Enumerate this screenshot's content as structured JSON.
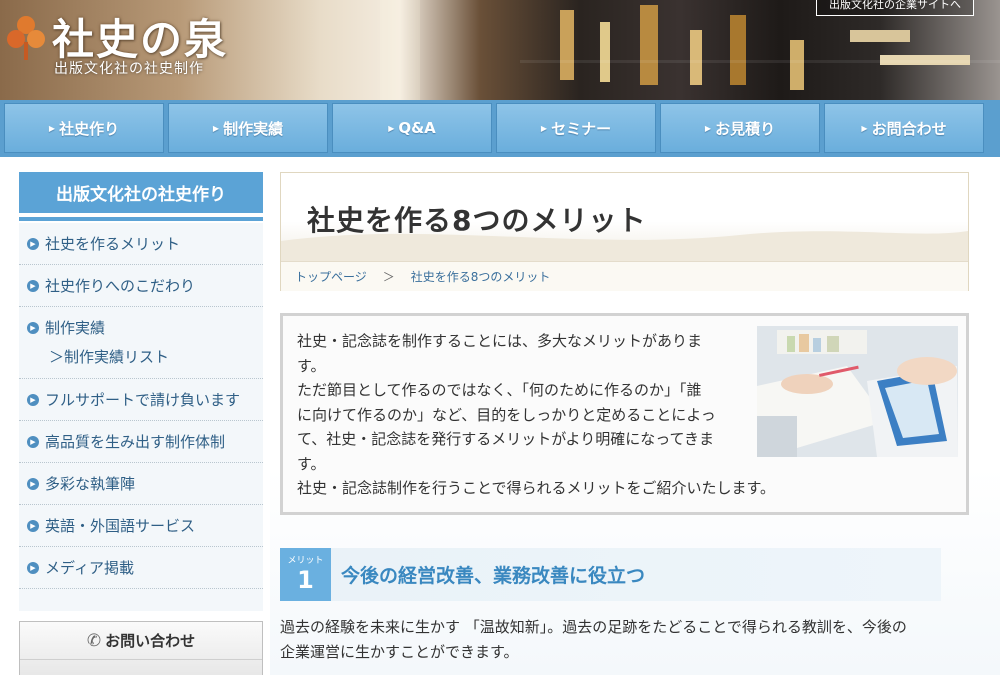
{
  "header": {
    "title": "社史の泉",
    "subtitle": "出版文化社の社史制作",
    "corporate_link": "出版文化社の企業サイトへ"
  },
  "nav": {
    "items": [
      {
        "label": "社史作り"
      },
      {
        "label": "制作実績"
      },
      {
        "label": "Q&A"
      },
      {
        "label": "セミナー"
      },
      {
        "label": "お見積り"
      },
      {
        "label": "お問合わせ"
      }
    ]
  },
  "sidebar": {
    "heading": "出版文化社の社史作り",
    "items": [
      {
        "label": "社史を作るメリット"
      },
      {
        "label": "社史作りへのこだわり"
      },
      {
        "label": "制作実績",
        "sub": "＞制作実績リスト"
      },
      {
        "label": "フルサポートで請け負います"
      },
      {
        "label": "高品質を生み出す制作体制"
      },
      {
        "label": "多彩な執筆陣"
      },
      {
        "label": "英語・外国語サービス"
      },
      {
        "label": "メディア掲載"
      }
    ],
    "contact": "お問い合わせ"
  },
  "main": {
    "page_title": "社史を作る8つのメリット",
    "breadcrumb": {
      "home": "トップページ",
      "separator": "＞",
      "current": "社史を作る8つのメリット"
    },
    "intro_lines": [
      "社史・記念誌を制作することには、多大なメリットがありま",
      "す。",
      "ただ節目として作るのではなく、「何のために作るのか」「誰",
      "に向けて作るのか」など、目的をしっかりと定めることによっ",
      "て、社史・記念誌を発行するメリットがより明確になってきま",
      "す。",
      "社史・記念誌制作を行うことで得られるメリットをご紹介いたします。"
    ],
    "merit": {
      "badge_label": "メリット",
      "number": "1",
      "title": "今後の経営改善、業務改善に役立つ",
      "text_lines": [
        "過去の経験を未来に生かす 「温故知新」。過去の足跡をたどることで得られる教訓を、今後の",
        "企業運営に生かすことができます。"
      ]
    }
  },
  "colors": {
    "nav_bar": "#5b9fcf",
    "nav_item": "#7ab8e2",
    "sidebar_heading": "#5ba3d6",
    "link": "#2f5f86",
    "merit_title": "#3a88c0"
  }
}
